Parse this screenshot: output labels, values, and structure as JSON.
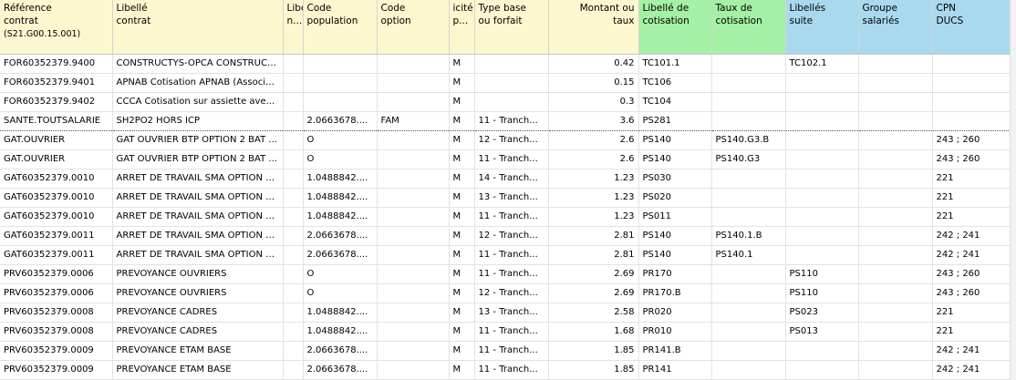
{
  "headers": [
    {
      "lines": [
        "Référence",
        "contrat",
        "(S21.G00.15.001)"
      ],
      "color": "yellow",
      "align": "left"
    },
    {
      "lines": [
        "Libellé",
        "contrat"
      ],
      "color": "yellow",
      "align": "left"
    },
    {
      "lines": [
        "Libe",
        "n..."
      ],
      "color": "yellow",
      "align": "left"
    },
    {
      "lines": [
        "Code",
        "population"
      ],
      "color": "yellow",
      "align": "left"
    },
    {
      "lines": [
        "Code",
        "option"
      ],
      "color": "yellow",
      "align": "left"
    },
    {
      "lines": [
        "icité",
        "p..."
      ],
      "color": "yellow",
      "align": "left"
    },
    {
      "lines": [
        "Type base",
        "ou forfait"
      ],
      "color": "yellow",
      "align": "left"
    },
    {
      "lines": [
        "Montant ou",
        "taux"
      ],
      "color": "yellow",
      "align": "right"
    },
    {
      "lines": [
        "Libellé de",
        "cotisation"
      ],
      "color": "green",
      "align": "left"
    },
    {
      "lines": [
        "Taux de",
        "cotisation"
      ],
      "color": "green",
      "align": "left"
    },
    {
      "lines": [
        "Libellés",
        "suite"
      ],
      "color": "blue",
      "align": "left"
    },
    {
      "lines": [
        "Groupe",
        "salariés"
      ],
      "color": "blue",
      "align": "left"
    },
    {
      "lines": [
        "CPN",
        "DUCS"
      ],
      "color": "blue",
      "align": "left"
    }
  ],
  "rows": [
    [
      "FOR60352379.9400",
      "CONSTRUCTYS-OPCA CONSTRUCTI...",
      "",
      "",
      "",
      "M",
      "",
      "0.42",
      "TC101.1",
      "",
      "TC102.1",
      "",
      ""
    ],
    [
      "FOR60352379.9401",
      "APNAB Cotisation APNAB (Associa...",
      "",
      "",
      "",
      "M",
      "",
      "0.15",
      "TC106",
      "",
      "",
      "",
      ""
    ],
    [
      "FOR60352379.9402",
      "CCCA Cotisation sur assiette ave...",
      "",
      "",
      "",
      "M",
      "",
      "0.3",
      "TC104",
      "",
      "",
      "",
      ""
    ],
    [
      "SANTE.TOUTSALARIE",
      "SH2PO2 HORS ICP",
      "",
      "2.0663678....",
      "FAM",
      "M",
      "11 - Tranch...",
      "3.6",
      "PS281",
      "",
      "",
      "",
      ""
    ],
    [
      "GAT.OUVRIER",
      "GAT OUVRIER BTP OPTION 2 BAT ...",
      "",
      "O",
      "",
      "M",
      "12 - Tranch...",
      "2.6",
      "PS140",
      "PS140.G3.B",
      "",
      "",
      "243 ; 260"
    ],
    [
      "GAT.OUVRIER",
      "GAT OUVRIER BTP OPTION 2 BAT ...",
      "",
      "O",
      "",
      "M",
      "11 - Tranch...",
      "2.6",
      "PS140",
      "PS140.G3",
      "",
      "",
      "243 ; 260"
    ],
    [
      "GAT60352379.0010",
      "ARRET DE TRAVAIL SMA OPTION 1 (...",
      "",
      "1.0488842....",
      "",
      "M",
      "14 - Tranch...",
      "1.23",
      "PS030",
      "",
      "",
      "",
      "221"
    ],
    [
      "GAT60352379.0010",
      "ARRET DE TRAVAIL SMA OPTION 1 (...",
      "",
      "1.0488842....",
      "",
      "M",
      "13 - Tranch...",
      "1.23",
      "PS020",
      "",
      "",
      "",
      "221"
    ],
    [
      "GAT60352379.0010",
      "ARRET DE TRAVAIL SMA OPTION 1 (...",
      "",
      "1.0488842....",
      "",
      "M",
      "11 - Tranch...",
      "1.23",
      "PS011",
      "",
      "",
      "",
      "221"
    ],
    [
      "GAT60352379.0011",
      "ARRET DE TRAVAIL SMA OPTION 5 (...",
      "",
      "2.0663678....",
      "",
      "M",
      "12 - Tranch...",
      "2.81",
      "PS140",
      "PS140.1.B",
      "",
      "",
      "242 ; 241"
    ],
    [
      "GAT60352379.0011",
      "ARRET DE TRAVAIL SMA OPTION 5 (...",
      "",
      "2.0663678....",
      "",
      "M",
      "11 - Tranch...",
      "2.81",
      "PS140",
      "PS140.1",
      "",
      "",
      "242 ; 241"
    ],
    [
      "PRV60352379.0006",
      "PREVOYANCE OUVRIERS",
      "",
      "O",
      "",
      "M",
      "11 - Tranch...",
      "2.69",
      "PR170",
      "",
      "PS110",
      "",
      "243 ; 260"
    ],
    [
      "PRV60352379.0006",
      "PREVOYANCE OUVRIERS",
      "",
      "O",
      "",
      "M",
      "12 - Tranch...",
      "2.69",
      "PR170.B",
      "",
      "PS110",
      "",
      "243 ; 260"
    ],
    [
      "PRV60352379.0008",
      "PREVOYANCE CADRES",
      "",
      "1.0488842....",
      "",
      "M",
      "13 - Tranch...",
      "2.58",
      "PR020",
      "",
      "PS023",
      "",
      "221"
    ],
    [
      "PRV60352379.0008",
      "PREVOYANCE CADRES",
      "",
      "1.0488842....",
      "",
      "M",
      "11 - Tranch...",
      "1.68",
      "PR010",
      "",
      "PS013",
      "",
      "221"
    ],
    [
      "PRV60352379.0009",
      "PREVOYANCE ETAM BASE",
      "",
      "2.0663678....",
      "",
      "M",
      "11 - Tranch...",
      "1.85",
      "PR141.B",
      "",
      "",
      "",
      "242 ; 241"
    ],
    [
      "PRV60352379.0009",
      "PREVOYANCE ETAM BASE",
      "",
      "2.0663678....",
      "",
      "M",
      "11 - Tranch...",
      "1.85",
      "PR141",
      "",
      "",
      "",
      "242 ; 241"
    ]
  ],
  "selected_row": 3
}
